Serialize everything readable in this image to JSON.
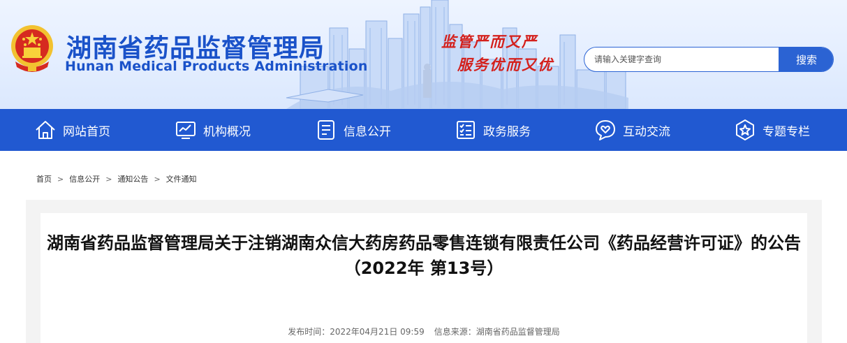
{
  "header": {
    "title": "湖南省药品监督管理局",
    "subtitle": "Hunan Medical Products Administration",
    "slogan_line1": "监管严而又严",
    "slogan_line2": "服务优而又优",
    "emblem_icon": "national-emblem-icon"
  },
  "search": {
    "placeholder": "请输入关键字查询",
    "button_label": "搜索"
  },
  "nav": {
    "items": [
      {
        "label": "网站首页",
        "icon": "home-icon"
      },
      {
        "label": "机构概况",
        "icon": "chart-monitor-icon"
      },
      {
        "label": "信息公开",
        "icon": "document-icon"
      },
      {
        "label": "政务服务",
        "icon": "checklist-icon"
      },
      {
        "label": "互动交流",
        "icon": "chat-heart-icon"
      },
      {
        "label": "专题专栏",
        "icon": "star-badge-icon"
      }
    ]
  },
  "breadcrumb": {
    "items": [
      "首页",
      "信息公开",
      "通知公告",
      "文件通知"
    ],
    "separator": ">"
  },
  "article": {
    "title": "湖南省药品监督管理局关于注销湖南众信大药房药品零售连锁有限责任公司《药品经营许可证》的公告（2022年 第13号）",
    "publish_label": "发布时间：",
    "publish_time": "2022年04月21日 09:59",
    "source_label": "信息来源：",
    "source": "湖南省药品监督管理局"
  },
  "colors": {
    "brand_blue": "#1a52c9",
    "nav_blue": "#2159d1",
    "slogan_red": "#d4201c",
    "banner_light": "#e4eeff"
  }
}
